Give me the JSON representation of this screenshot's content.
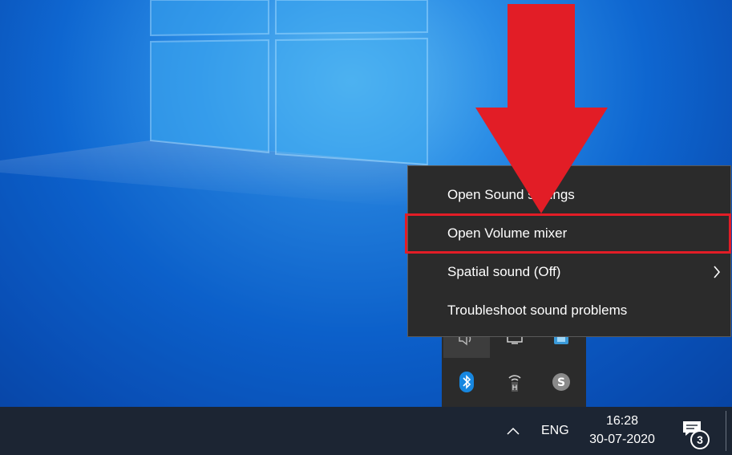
{
  "context_menu": {
    "items": [
      {
        "label": "Open Sound settings",
        "has_submenu": false
      },
      {
        "label": "Open Volume mixer",
        "has_submenu": false,
        "highlighted": true
      },
      {
        "label": "Spatial sound (Off)",
        "has_submenu": true
      },
      {
        "label": "Troubleshoot sound problems",
        "has_submenu": false
      }
    ]
  },
  "tray_overflow": {
    "icons": [
      "speaker-icon",
      "display-icon",
      "app-icon",
      "bluetooth-icon",
      "wifi-hotspot-icon",
      "skype-icon"
    ]
  },
  "taskbar": {
    "chevron_icon": "chevron-up-icon",
    "language": "ENG",
    "time": "16:28",
    "date": "30-07-2020",
    "notification_count": "3"
  },
  "annotation": {
    "arrow_color": "#e21d26",
    "highlight_color": "#e21d26"
  }
}
